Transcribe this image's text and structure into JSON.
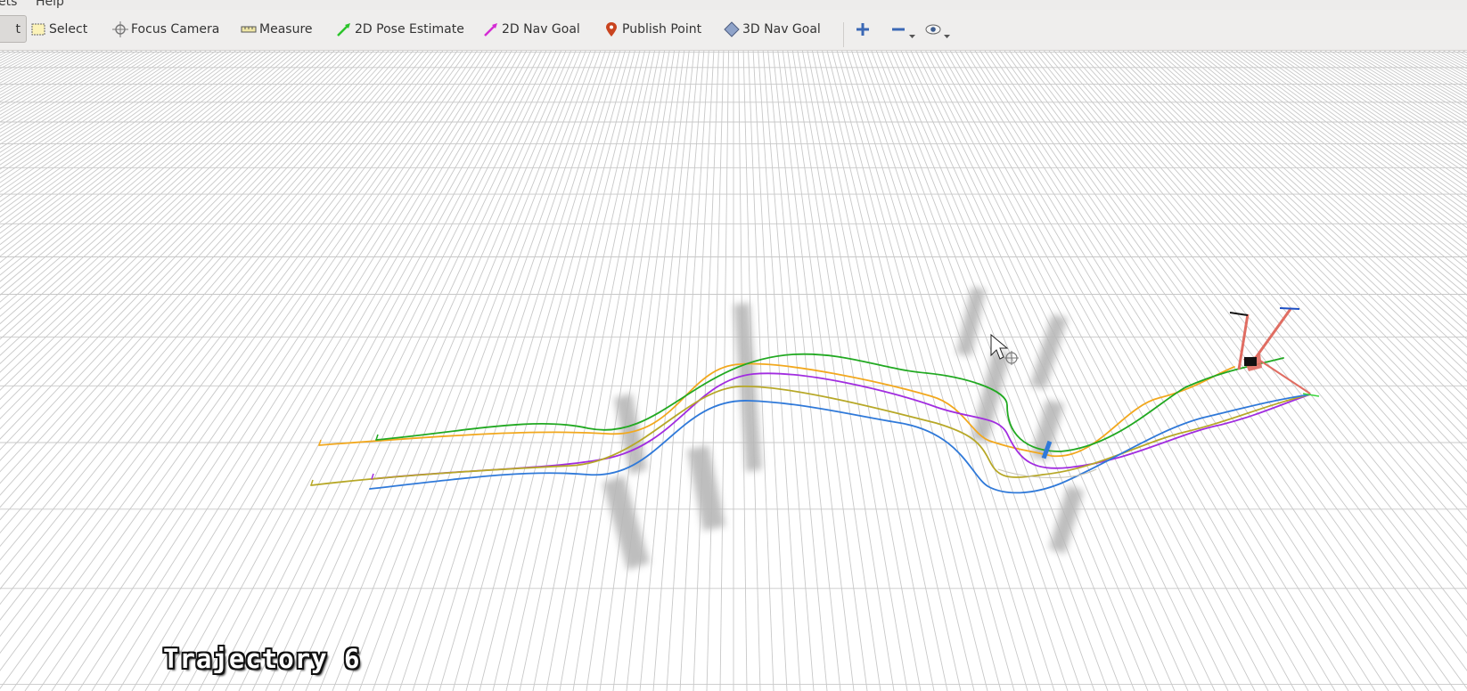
{
  "menu": {
    "items": [
      "ets",
      "Help"
    ]
  },
  "toolbar": {
    "tools": [
      {
        "id": "interact",
        "label": "t",
        "icon": "interact-icon",
        "active": true
      },
      {
        "id": "select",
        "label": "Select",
        "icon": "select-icon"
      },
      {
        "id": "focus_camera",
        "label": "Focus Camera",
        "icon": "crosshair-icon"
      },
      {
        "id": "measure",
        "label": "Measure",
        "icon": "ruler-icon"
      },
      {
        "id": "pose_estimate",
        "label": "2D Pose Estimate",
        "icon": "green-arrow-icon"
      },
      {
        "id": "nav_goal",
        "label": "2D Nav Goal",
        "icon": "magenta-arrow-icon"
      },
      {
        "id": "publish_point",
        "label": "Publish Point",
        "icon": "map-pin-icon"
      },
      {
        "id": "nav_goal_3d",
        "label": "3D Nav Goal",
        "icon": "diamond-icon"
      }
    ],
    "extra_icons": [
      "plus-icon",
      "minus-icon",
      "eye-icon"
    ]
  },
  "viewport": {
    "overlay_title": "Trajectory 6",
    "grid_color": "#c8c8c8",
    "trajectory_colors": [
      "#f2a81d",
      "#21a921",
      "#a12ce0",
      "#b7a827",
      "#2f79d9"
    ]
  }
}
